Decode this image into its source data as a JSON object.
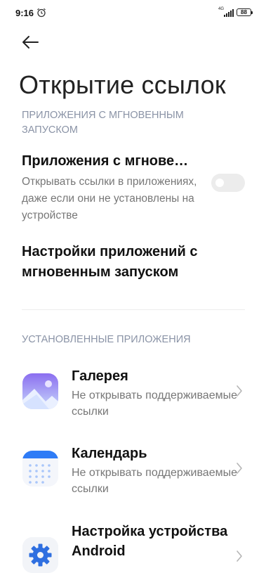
{
  "status_bar": {
    "time": "9:16",
    "network": "4G",
    "battery": "88"
  },
  "page": {
    "title": "Открытие ссылок"
  },
  "instant_section": {
    "header": "ПРИЛОЖЕНИЯ С МГНОВЕННЫМ ЗАПУСКОМ",
    "toggle_title": "Приложения с мгнове…",
    "toggle_description": "Открывать ссылки в приложениях, даже если они не установлены на устройстве",
    "toggle_on": false,
    "settings_label": "Настройки приложений с мгновенным запуском"
  },
  "installed_section": {
    "header": "УСТАНОВЛЕННЫЕ ПРИЛОЖЕНИЯ",
    "apps": [
      {
        "name": "Галерея",
        "status": "Не открывать поддерживаемые ссылки",
        "icon": "gallery-icon"
      },
      {
        "name": "Календарь",
        "status": "Не открывать поддерживаемые ссылки",
        "icon": "calendar-icon"
      },
      {
        "name": "Настройка устройства Android",
        "status": "",
        "icon": "settings-gear-icon"
      }
    ]
  },
  "colors": {
    "accent_blue": "#2f7cf6",
    "gallery_purple": "#9a7cf2",
    "muted_text": "#777777",
    "section_header": "#8a93a6"
  }
}
